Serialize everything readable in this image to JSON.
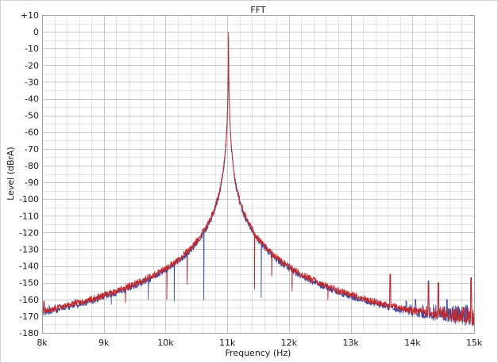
{
  "chart_data": {
    "type": "line",
    "title": "FFT",
    "xlabel": "Frequency (Hz)",
    "ylabel": "Level (dBrA)",
    "xlim": [
      8000,
      15000
    ],
    "ylim": [
      -180,
      10
    ],
    "x_ticks": [
      {
        "value": 8000,
        "label": "8k"
      },
      {
        "value": 9000,
        "label": "9k"
      },
      {
        "value": 10000,
        "label": "10k"
      },
      {
        "value": 11000,
        "label": "11k"
      },
      {
        "value": 12000,
        "label": "12k"
      },
      {
        "value": 13000,
        "label": "13k"
      },
      {
        "value": 14000,
        "label": "14k"
      },
      {
        "value": 15000,
        "label": "15k"
      }
    ],
    "y_ticks": [
      {
        "value": 10,
        "label": "+10"
      },
      {
        "value": 0,
        "label": "0"
      },
      {
        "value": -10,
        "label": "-10"
      },
      {
        "value": -20,
        "label": "-20"
      },
      {
        "value": -30,
        "label": "-30"
      },
      {
        "value": -40,
        "label": "-40"
      },
      {
        "value": -50,
        "label": "-50"
      },
      {
        "value": -60,
        "label": "-60"
      },
      {
        "value": -70,
        "label": "-70"
      },
      {
        "value": -80,
        "label": "-80"
      },
      {
        "value": -90,
        "label": "-90"
      },
      {
        "value": -100,
        "label": "-100"
      },
      {
        "value": -110,
        "label": "-110"
      },
      {
        "value": -120,
        "label": "-120"
      },
      {
        "value": -130,
        "label": "-130"
      },
      {
        "value": -140,
        "label": "-140"
      },
      {
        "value": -150,
        "label": "-150"
      },
      {
        "value": -160,
        "label": "-160"
      },
      {
        "value": -170,
        "label": "-170"
      },
      {
        "value": -180,
        "label": "-180"
      }
    ],
    "grid": true,
    "minor_x_per_major": 5,
    "minor_y_per_major": 2,
    "colors": {
      "grid_major": "#c8c8c8",
      "grid_minor": "#e4e4e4",
      "channel_a": "#3b4aa0",
      "channel_b": "#c62828"
    },
    "series": [
      {
        "color": "#3b4aa0",
        "noise_floor": [
          -180,
          -163
        ],
        "fundamental": {
          "x": 11020,
          "y": -3
        },
        "spurs": [
          {
            "x": 8030,
            "y": -162
          },
          {
            "x": 8540,
            "y": -160
          },
          {
            "x": 8660,
            "y": -162
          },
          {
            "x": 8870,
            "y": -160
          },
          {
            "x": 9120,
            "y": -163
          },
          {
            "x": 9350,
            "y": -161
          },
          {
            "x": 9720,
            "y": -160
          },
          {
            "x": 10020,
            "y": -159
          },
          {
            "x": 10140,
            "y": -161
          },
          {
            "x": 10350,
            "y": -148
          },
          {
            "x": 10620,
            "y": -160
          },
          {
            "x": 11440,
            "y": -152
          },
          {
            "x": 11550,
            "y": -159
          },
          {
            "x": 11720,
            "y": -146
          },
          {
            "x": 12050,
            "y": -153
          },
          {
            "x": 12630,
            "y": -158
          },
          {
            "x": 12950,
            "y": -159
          },
          {
            "x": 13120,
            "y": -161
          },
          {
            "x": 13410,
            "y": -160
          },
          {
            "x": 13640,
            "y": -145
          },
          {
            "x": 13900,
            "y": -161
          },
          {
            "x": 14050,
            "y": -160
          },
          {
            "x": 14260,
            "y": -149
          },
          {
            "x": 14420,
            "y": -150
          },
          {
            "x": 14560,
            "y": -160
          },
          {
            "x": 14950,
            "y": -147
          }
        ]
      },
      {
        "color": "#c62828",
        "noise_floor": [
          -180,
          -164
        ],
        "fundamental": {
          "x": 11020,
          "y": -2
        },
        "spurs": [
          {
            "x": 8030,
            "y": -161
          },
          {
            "x": 8540,
            "y": -162
          },
          {
            "x": 8660,
            "y": -162
          },
          {
            "x": 8870,
            "y": -161
          },
          {
            "x": 9350,
            "y": -162
          },
          {
            "x": 10020,
            "y": -160
          },
          {
            "x": 10350,
            "y": -151
          },
          {
            "x": 11440,
            "y": -154
          },
          {
            "x": 11720,
            "y": -146
          },
          {
            "x": 12050,
            "y": -155
          },
          {
            "x": 12630,
            "y": -160
          },
          {
            "x": 13640,
            "y": -145
          },
          {
            "x": 14260,
            "y": -151
          },
          {
            "x": 14420,
            "y": -150
          },
          {
            "x": 14950,
            "y": -148
          }
        ]
      }
    ]
  }
}
